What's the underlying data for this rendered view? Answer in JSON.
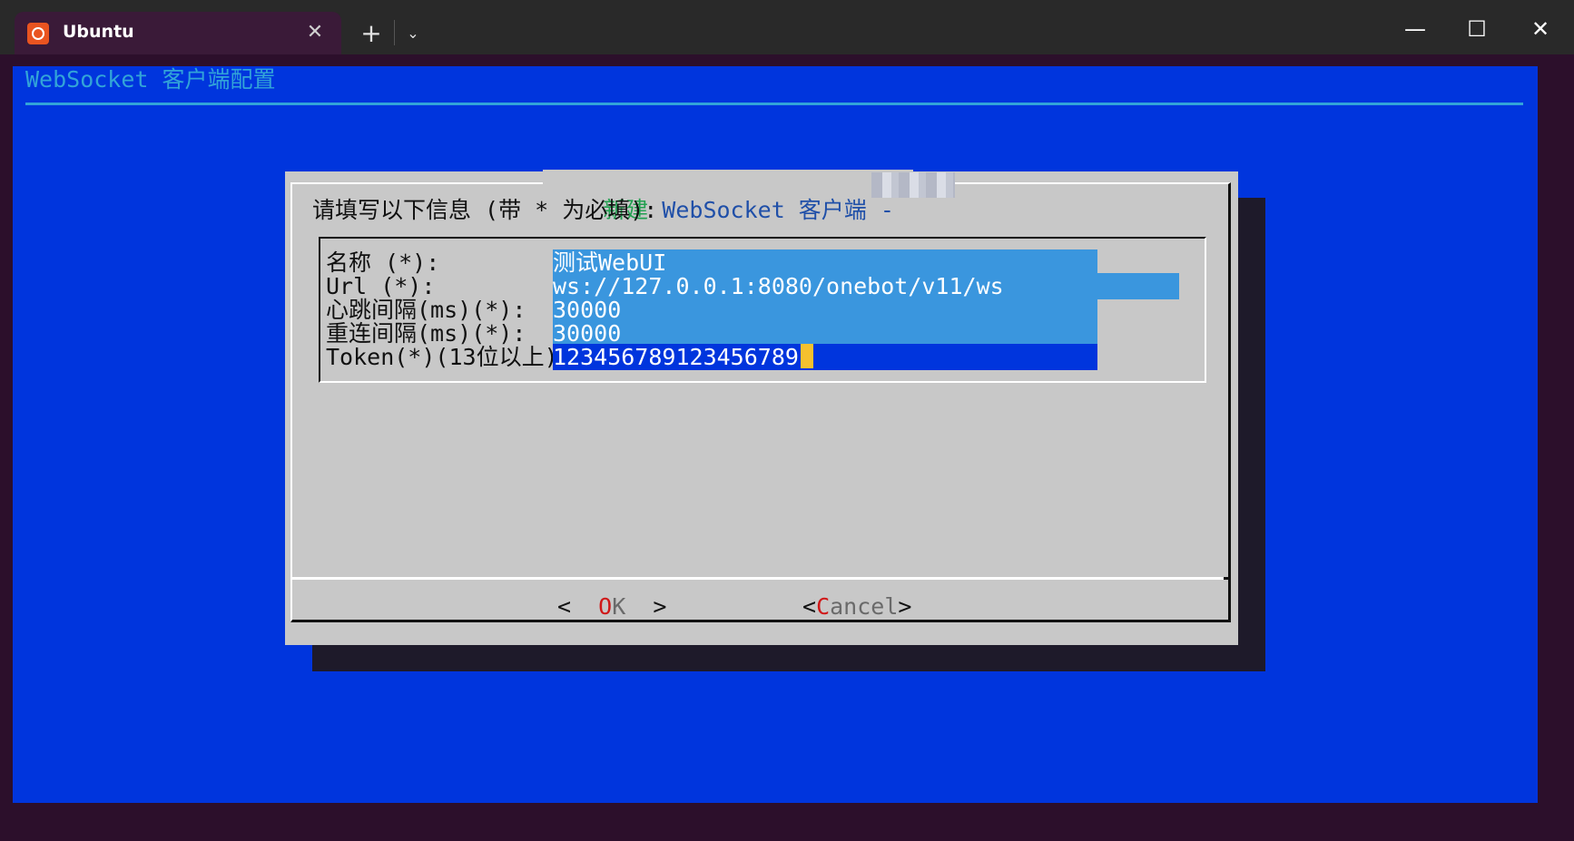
{
  "window": {
    "tab_title": "Ubuntu",
    "tab_close": "✕",
    "new_tab": "+",
    "dropdown": "⌄",
    "minimize": "—",
    "maximize": "☐",
    "close": "✕"
  },
  "terminal": {
    "title": "WebSocket 客户端配置"
  },
  "dialog": {
    "title_hot": "新建",
    "title_rest": " WebSocket 客户端 - ",
    "prompt": "请填写以下信息 (带 * 为必填):",
    "fields": [
      {
        "label": "名称 (*):",
        "value": "测试WebUI"
      },
      {
        "label": "Url (*):",
        "value": "ws://127.0.0.1:8080/onebot/v11/ws"
      },
      {
        "label": "心跳间隔(ms)(*):",
        "value": "30000"
      },
      {
        "label": "重连间隔(ms)(*):",
        "value": "30000"
      },
      {
        "label": "Token(*)(13位以上)",
        "value": "123456789123456789"
      }
    ],
    "ok": {
      "left": "<  ",
      "hot": "O",
      "rest": "K",
      "right": "  >"
    },
    "cancel": {
      "left": "<",
      "hot": "C",
      "rest": "ancel",
      "right": ">"
    }
  },
  "colors": {
    "terminal_bg": "#0035dd",
    "dialog_bg": "#c8c8c8",
    "field_bg": "#3a96de",
    "cursor": "#f5c12e",
    "hotkey": "#d01818"
  }
}
